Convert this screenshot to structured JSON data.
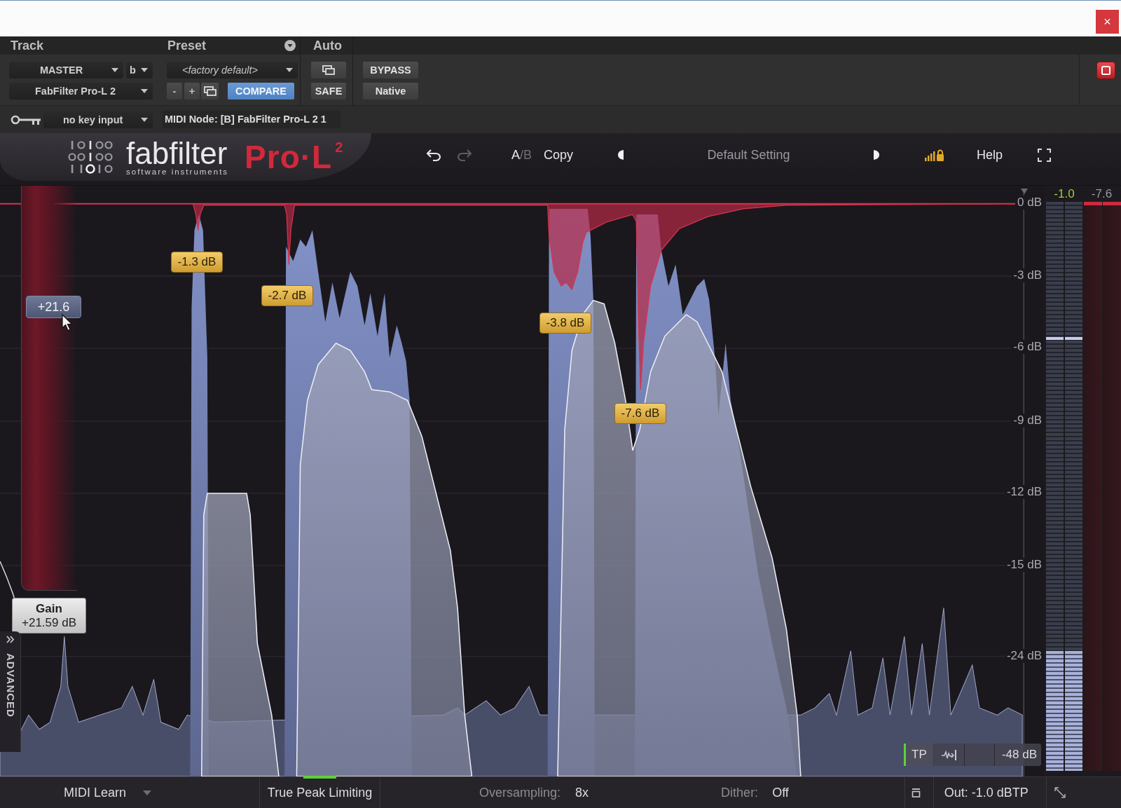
{
  "window": {
    "close_glyph": "×"
  },
  "host": {
    "labels": {
      "track": "Track",
      "preset": "Preset",
      "auto": "Auto"
    },
    "track_select": "MASTER",
    "channel_select": "b",
    "plugin_select": "FabFilter Pro-L 2",
    "preset_select": "<factory default>",
    "preset_step_buttons": [
      "-",
      "+"
    ],
    "compare": {
      "label": "COMPARE",
      "on": true
    },
    "safe": "SAFE",
    "bypass": "BYPASS",
    "native": "Native",
    "key_input": "no key input",
    "midi_node": "MIDI Node: [B] FabFilter Pro-L 2 1"
  },
  "plugin_header": {
    "brand": "fabfilter",
    "tagline": "software instruments",
    "product": "Pro·L$^{2}$",
    "redo_enabled": false,
    "ab": [
      {
        "label": "A",
        "selected": true
      },
      {
        "label": "B",
        "selected": false
      }
    ],
    "ab_separator": "/",
    "copy": "Copy",
    "preset_name": "Default Setting",
    "help": "Help"
  },
  "display": {
    "scale": [
      "0 dB",
      "-3 dB",
      "-6 dB",
      "-9 dB",
      "-12 dB",
      "-15 dB",
      "-24 dB"
    ],
    "peak_reductions": [
      "-1.3 dB",
      "-2.7 dB",
      "-3.8 dB",
      "-7.6 dB"
    ],
    "gain": {
      "handle": "+21.6",
      "level": 0.7,
      "tooltip_title": "Gain",
      "tooltip_value": "+21.59 dB"
    },
    "advanced_tab": "ADVANCED",
    "meter_toggles": [
      {
        "kind": "text",
        "label": "TP",
        "on": true
      },
      {
        "kind": "icon",
        "on": false
      }
    ],
    "meter_range": "-48 dB"
  },
  "meters": {
    "output_peak": "-1.0",
    "reduction_peak": "-7.6",
    "output_channels": [
      {
        "level": 0.21,
        "hold": {
          "level": 0.76
        }
      },
      {
        "level": 0.21,
        "hold": {
          "level": 0.76
        }
      }
    ],
    "reduction_channels": [
      {
        "level": 0.006
      },
      {
        "level": 0.006
      }
    ]
  },
  "bottom_bar": {
    "midi_learn": "MIDI Learn",
    "true_peak": {
      "label": "True Peak Limiting",
      "on": true
    },
    "oversampling_label": "Oversampling:",
    "oversampling_value": "8x",
    "dither_label": "Dither:",
    "dither_value": "Off",
    "output": "Out: -1.0 dBTP"
  }
}
